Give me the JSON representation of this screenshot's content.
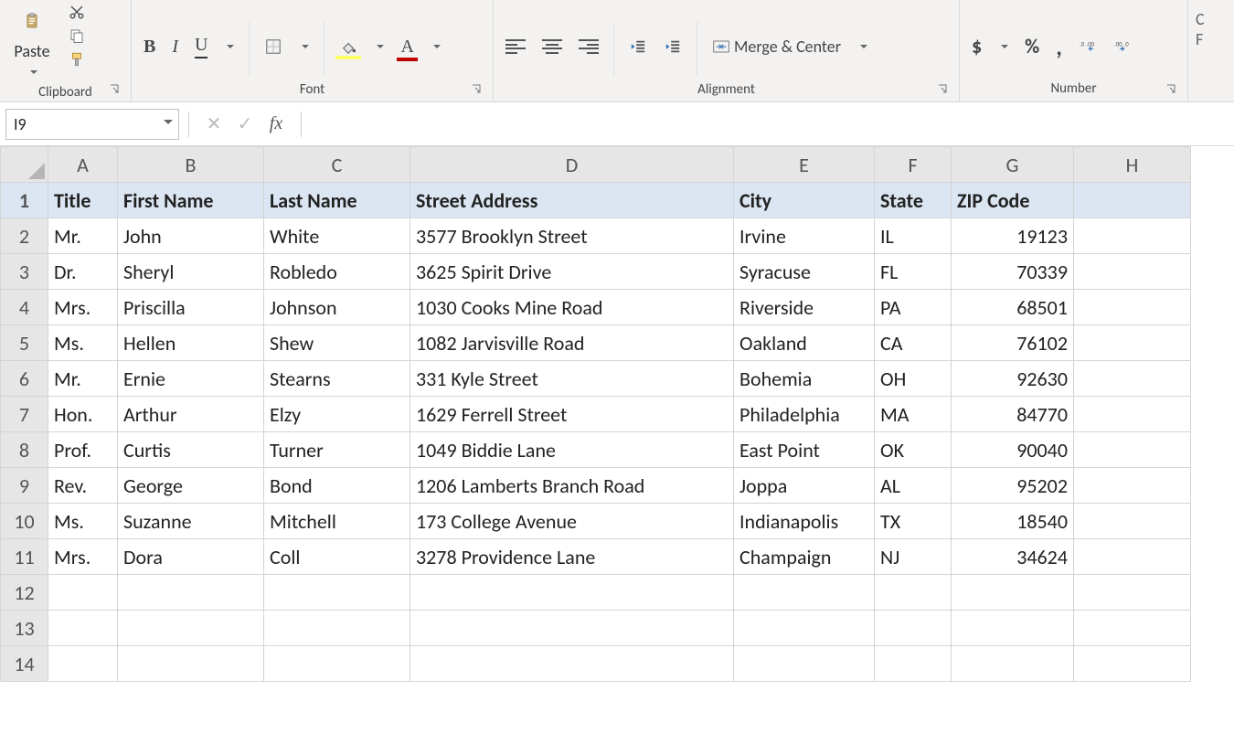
{
  "ribbon": {
    "clipboard": {
      "label": "Clipboard",
      "paste": "Paste"
    },
    "font": {
      "label": "Font",
      "bold": "B",
      "italic": "I",
      "underline": "U",
      "fontcolor": "A"
    },
    "alignment": {
      "label": "Alignment",
      "merge": "Merge & Center"
    },
    "number": {
      "label": "Number",
      "currency": "$",
      "percent": "%",
      "comma": ","
    }
  },
  "formula_bar": {
    "name_box": "I9",
    "fx": "fx",
    "formula": ""
  },
  "columns": [
    "A",
    "B",
    "C",
    "D",
    "E",
    "F",
    "G",
    "H"
  ],
  "row_numbers": [
    1,
    2,
    3,
    4,
    5,
    6,
    7,
    8,
    9,
    10,
    11,
    12,
    13,
    14
  ],
  "headers": [
    "Title",
    "First Name",
    "Last Name",
    "Street Address",
    "City",
    "State",
    "ZIP Code"
  ],
  "rows": [
    {
      "title": "Mr.",
      "first": "John",
      "last": "White",
      "street": "3577 Brooklyn Street",
      "city": "Irvine",
      "state": "IL",
      "zip": "19123"
    },
    {
      "title": "Dr.",
      "first": "Sheryl",
      "last": "Robledo",
      "street": "3625 Spirit Drive",
      "city": "Syracuse",
      "state": "FL",
      "zip": "70339"
    },
    {
      "title": "Mrs.",
      "first": "Priscilla",
      "last": "Johnson",
      "street": "1030 Cooks Mine Road",
      "city": "Riverside",
      "state": "PA",
      "zip": "68501"
    },
    {
      "title": "Ms.",
      "first": "Hellen",
      "last": "Shew",
      "street": "1082 Jarvisville Road",
      "city": "Oakland",
      "state": "CA",
      "zip": "76102"
    },
    {
      "title": "Mr.",
      "first": "Ernie",
      "last": "Stearns",
      "street": "331 Kyle Street",
      "city": "Bohemia",
      "state": "OH",
      "zip": "92630"
    },
    {
      "title": "Hon.",
      "first": "Arthur",
      "last": "Elzy",
      "street": "1629 Ferrell Street",
      "city": "Philadelphia",
      "state": "MA",
      "zip": "84770"
    },
    {
      "title": "Prof.",
      "first": "Curtis",
      "last": "Turner",
      "street": "1049 Biddie Lane",
      "city": "East Point",
      "state": "OK",
      "zip": "90040"
    },
    {
      "title": "Rev.",
      "first": "George",
      "last": "Bond",
      "street": "1206 Lamberts Branch Road",
      "city": "Joppa",
      "state": "AL",
      "zip": "95202"
    },
    {
      "title": "Ms.",
      "first": "Suzanne",
      "last": "Mitchell",
      "street": "173 College Avenue",
      "city": "Indianapolis",
      "state": "TX",
      "zip": "18540"
    },
    {
      "title": "Mrs.",
      "first": "Dora",
      "last": "Coll",
      "street": "3278 Providence Lane",
      "city": "Champaign",
      "state": "NJ",
      "zip": "34624"
    }
  ],
  "chart_data": {
    "type": "table",
    "title": "",
    "columns": [
      "Title",
      "First Name",
      "Last Name",
      "Street Address",
      "City",
      "State",
      "ZIP Code"
    ],
    "rows": [
      [
        "Mr.",
        "John",
        "White",
        "3577 Brooklyn Street",
        "Irvine",
        "IL",
        19123
      ],
      [
        "Dr.",
        "Sheryl",
        "Robledo",
        "3625 Spirit Drive",
        "Syracuse",
        "FL",
        70339
      ],
      [
        "Mrs.",
        "Priscilla",
        "Johnson",
        "1030 Cooks Mine Road",
        "Riverside",
        "PA",
        68501
      ],
      [
        "Ms.",
        "Hellen",
        "Shew",
        "1082 Jarvisville Road",
        "Oakland",
        "CA",
        76102
      ],
      [
        "Mr.",
        "Ernie",
        "Stearns",
        "331 Kyle Street",
        "Bohemia",
        "OH",
        92630
      ],
      [
        "Hon.",
        "Arthur",
        "Elzy",
        "1629 Ferrell Street",
        "Philadelphia",
        "MA",
        84770
      ],
      [
        "Prof.",
        "Curtis",
        "Turner",
        "1049 Biddie Lane",
        "East Point",
        "OK",
        90040
      ],
      [
        "Rev.",
        "George",
        "Bond",
        "1206 Lamberts Branch Road",
        "Joppa",
        "AL",
        95202
      ],
      [
        "Ms.",
        "Suzanne",
        "Mitchell",
        "173 College Avenue",
        "Indianapolis",
        "TX",
        18540
      ],
      [
        "Mrs.",
        "Dora",
        "Coll",
        "3278 Providence Lane",
        "Champaign",
        "NJ",
        34624
      ]
    ]
  }
}
